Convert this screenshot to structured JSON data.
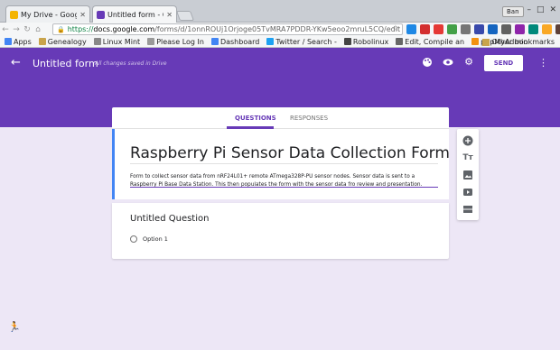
{
  "browser": {
    "tabs": [
      {
        "title": "My Drive - Google D",
        "favicon_color": "#f4b400",
        "active": false
      },
      {
        "title": "Untitled form - Goog",
        "favicon_color": "#673ab7",
        "active": true
      }
    ],
    "user_badge": "Ban",
    "url": {
      "scheme": "https://",
      "host": "docs.google.com",
      "path": "/forms/d/1onnROUj1Orjoge05TvMRA7PDDR-YKw5eoo2mruL5CQ/edit"
    },
    "bookmarks": [
      {
        "label": "Apps",
        "icon_color": "#4285f4"
      },
      {
        "label": "Genealogy",
        "icon_color": "#c9a44b"
      },
      {
        "label": "Linux Mint",
        "icon_color": "#888888"
      },
      {
        "label": "Please Log In",
        "icon_color": "#999999"
      },
      {
        "label": "Dashboard",
        "icon_color": "#4285f4"
      },
      {
        "label": "Twitter / Search -",
        "icon_color": "#1da1f2"
      },
      {
        "label": "Robolinux",
        "icon_color": "#444444"
      },
      {
        "label": "Edit, Compile an",
        "icon_color": "#666666"
      },
      {
        "label": "phpMyAdmin",
        "icon_color": "#f29111"
      }
    ],
    "other_bookmarks": "Other bookmarks"
  },
  "header": {
    "title": "Untitled form",
    "saved_note": "All changes saved in Drive",
    "send_label": "SEND",
    "icons": [
      "palette-icon",
      "preview-eye-icon",
      "settings-gear-icon",
      "more-vert-icon"
    ],
    "accent": "#673ab7"
  },
  "form": {
    "tabs": {
      "questions": "QUESTIONS",
      "responses": "RESPONSES"
    },
    "name": "Raspberry Pi Sensor Data Collection Form",
    "description": "Form to collect sensor data from nRF24L01+ remote ATmega328P-PU sensor nodes. Sensor data is sent to a Raspberry Pi Base Data Station. This then populates the form with the sensor data fro review and presentation.",
    "question": {
      "title": "Untitled Question",
      "options": [
        "Option 1"
      ]
    }
  },
  "side_toolbar": [
    "add-question-icon",
    "add-title-icon",
    "add-image-icon",
    "add-video-icon",
    "add-section-icon"
  ]
}
